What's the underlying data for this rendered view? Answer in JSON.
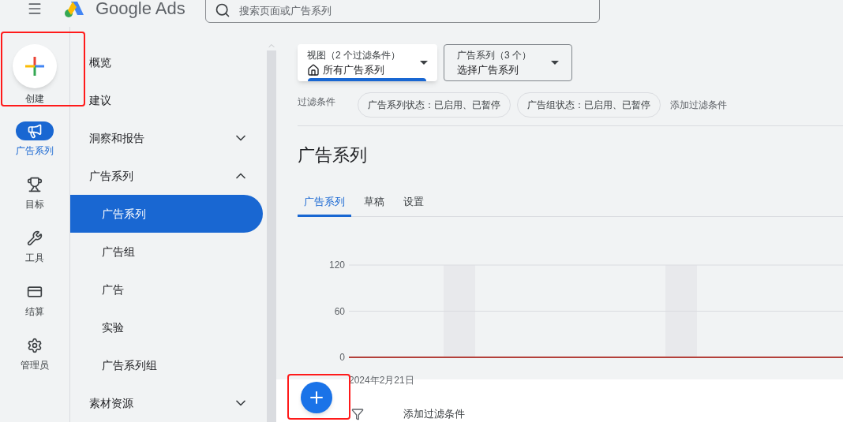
{
  "header": {
    "logo_text": "Google Ads",
    "search": {
      "placeholder": "搜索页面或广告系列"
    }
  },
  "create": {
    "label": "创建"
  },
  "rail": [
    {
      "kind": "campaigns",
      "label": "广告系列",
      "selected": true
    },
    {
      "kind": "goals",
      "label": "目标",
      "selected": false
    },
    {
      "kind": "tools",
      "label": "工具",
      "selected": false
    },
    {
      "kind": "billing",
      "label": "结算",
      "selected": false
    },
    {
      "kind": "admin",
      "label": "管理员",
      "selected": false
    }
  ],
  "nav": [
    {
      "label": "概览",
      "selected": false
    },
    {
      "label": "建议",
      "selected": false
    },
    {
      "label": "洞察和报告",
      "selected": false,
      "expanded": false
    },
    {
      "label": "广告系列",
      "selected": false,
      "expanded": true,
      "children": [
        {
          "label": "广告系列",
          "selected": true
        },
        {
          "label": "广告组",
          "selected": false
        },
        {
          "label": "广告",
          "selected": false
        },
        {
          "label": "实验",
          "selected": false
        },
        {
          "label": "广告系列组",
          "selected": false
        }
      ]
    },
    {
      "label": "素材资源",
      "selected": false,
      "expanded": false
    }
  ],
  "view_dropdown": {
    "label": "视图（2 个过滤条件）",
    "value": "所有广告系列"
  },
  "campaign_dropdown": {
    "label": "广告系列（3 个）",
    "value": "选择广告系列"
  },
  "filters": {
    "label": "过滤条件",
    "chips": [
      "广告系列状态：已启用、已暂停",
      "广告组状态：已启用、已暂停"
    ],
    "add": "添加过滤条件"
  },
  "page_title": "广告系列",
  "tabs": [
    {
      "label": "广告系列",
      "selected": true
    },
    {
      "label": "草稿",
      "selected": false
    },
    {
      "label": "设置",
      "selected": false
    }
  ],
  "chart": {
    "date_label": "2024年2月21日",
    "chart_data": {
      "type": "line",
      "ylim": [
        0,
        120
      ],
      "yticks": [
        0,
        60,
        120
      ],
      "series": [
        {
          "color": "#b3403a",
          "values": [
            0,
            0,
            0,
            0,
            0,
            0,
            0,
            0,
            0,
            0,
            0,
            0,
            0,
            0,
            0,
            0,
            0,
            0,
            0,
            0,
            0,
            0,
            0,
            0,
            0
          ]
        }
      ]
    }
  },
  "table_toolbar": {
    "add_filter": "添加过滤条件"
  }
}
